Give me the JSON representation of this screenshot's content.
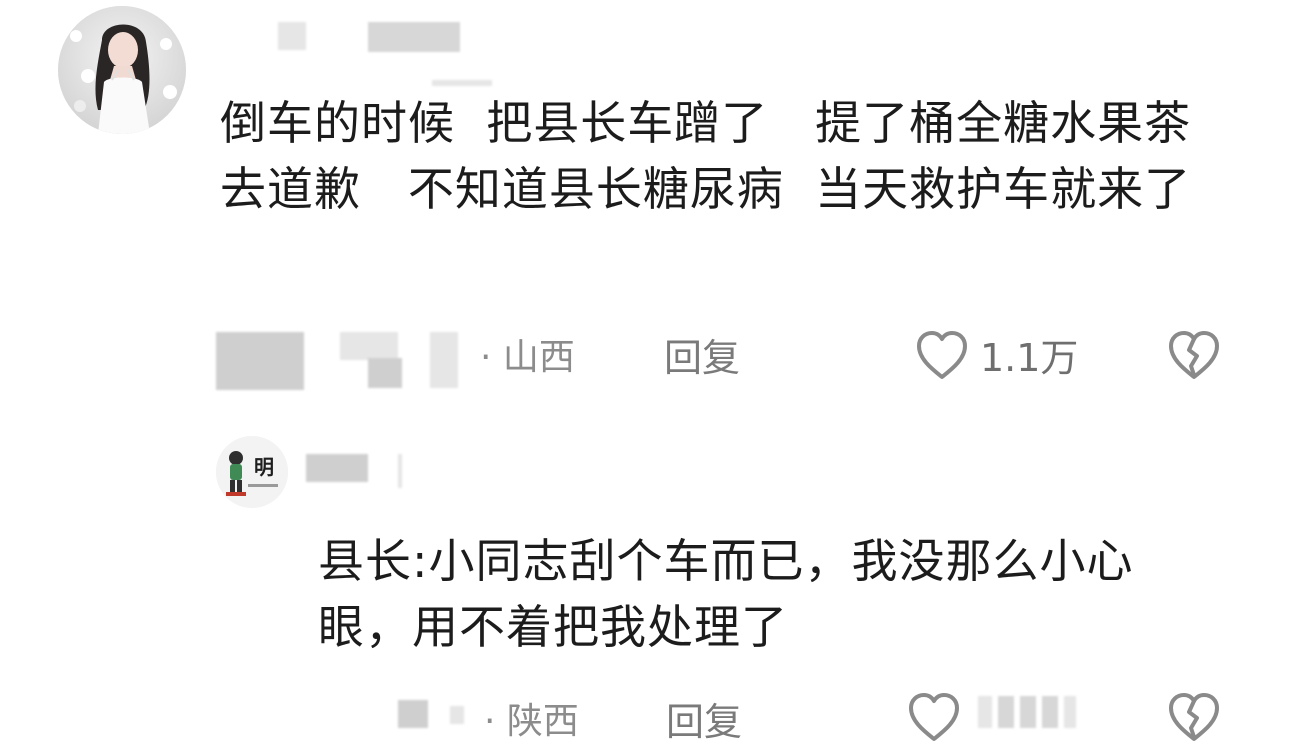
{
  "comments": [
    {
      "text": "倒车的时候  把县长车蹭了   提了桶全糖水果茶去道歉   不知道县长糖尿病  当天救护车就来了",
      "location": "· 山西",
      "reply_label": "回复",
      "like_count": "1.1万",
      "icons": {
        "like": "heart-outline-icon",
        "dislike": "broken-heart-icon"
      }
    },
    {
      "text": "县长:小同志刮个车而已，我没那么小心眼，用不着把我处理了",
      "location": "· 陕西",
      "reply_label": "回复",
      "avatar_text": "明",
      "icons": {
        "like": "heart-outline-icon",
        "dislike": "broken-heart-icon"
      }
    }
  ],
  "colors": {
    "text": "#1c1c1c",
    "meta": "#8c8c8c",
    "icon": "#8a8a8a"
  }
}
